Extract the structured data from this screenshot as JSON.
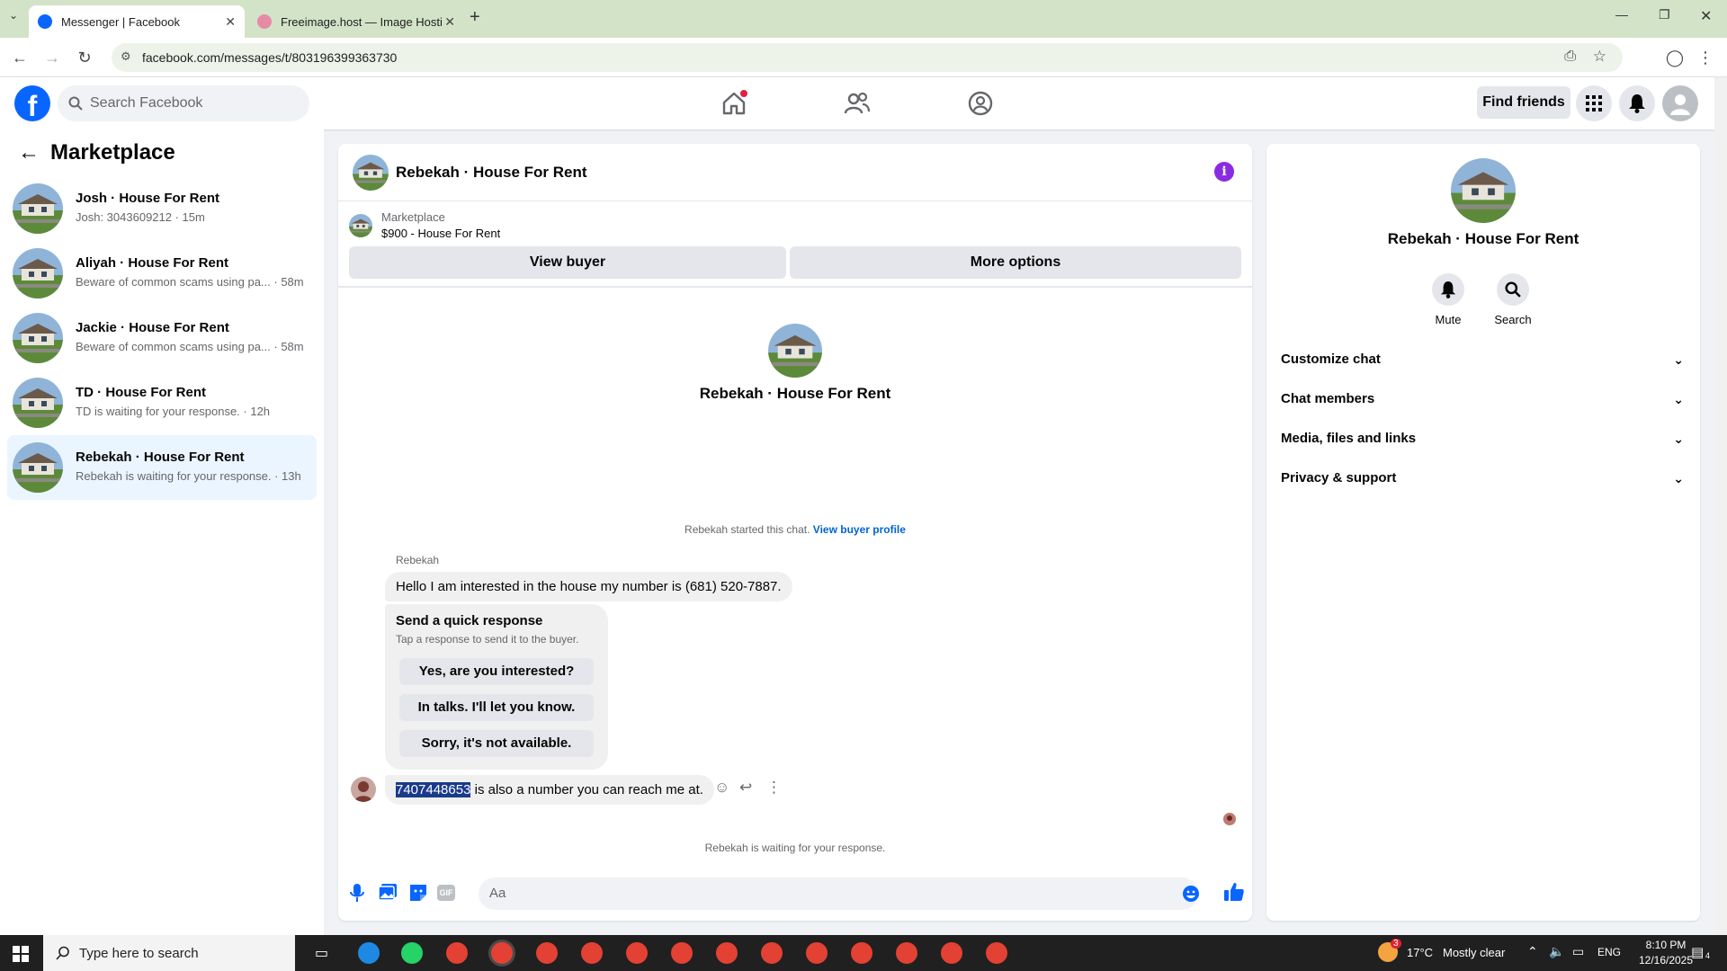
{
  "browser": {
    "tabs": [
      {
        "title": "Messenger | Facebook",
        "active": true
      },
      {
        "title": "Freeimage.host — Image Hosti",
        "active": false
      }
    ],
    "url": "facebook.com/messages/t/803196399363730"
  },
  "fb_header": {
    "search_placeholder": "Search Facebook",
    "find_friends_label": "Find friends"
  },
  "left_pane": {
    "title": "Marketplace",
    "conversations": [
      {
        "name": "Josh · House For Rent",
        "preview": "Josh: 3043609212 · 15m",
        "selected": false
      },
      {
        "name": "Aliyah · House For Rent",
        "preview": "Beware of common scams using pa... · 58m",
        "selected": false
      },
      {
        "name": "Jackie · House For Rent",
        "preview": "Beware of common scams using pa... · 58m",
        "selected": false
      },
      {
        "name": "TD · House For Rent",
        "preview": "TD is waiting for your response. · 12h",
        "selected": false
      },
      {
        "name": "Rebekah · House For Rent",
        "preview": "Rebekah is waiting for your response. · 13h",
        "selected": true
      }
    ]
  },
  "chat": {
    "title": "Rebekah · House For Rent",
    "listing": {
      "category": "Marketplace",
      "title": "$900 - House For Rent",
      "view_buyer_label": "View buyer",
      "more_options_label": "More options"
    },
    "profile_name": "Rebekah · House For Rent",
    "started_text": "Rebekah started this chat.",
    "view_profile_link": "View buyer profile",
    "sender_name": "Rebekah",
    "messages": {
      "first": "Hello I am interested in the house my number is (681) 520-7887.",
      "second_highlight": "7407448653",
      "second_rest": " is also a number you can reach me at."
    },
    "quick_response": {
      "title": "Send a quick response",
      "subtitle": "Tap a response to send it to the buyer.",
      "options": [
        "Yes, are you interested?",
        "In talks. I'll let you know.",
        "Sorry, it's not available."
      ]
    },
    "waiting_text": "Rebekah is waiting for your response.",
    "composer_placeholder": "Aa"
  },
  "right_pane": {
    "name": "Rebekah · House For Rent",
    "actions": [
      {
        "label": "Mute",
        "icon": "bell-icon"
      },
      {
        "label": "Search",
        "icon": "search-icon"
      }
    ],
    "sections": [
      "Customize chat",
      "Chat members",
      "Media, files and links",
      "Privacy & support"
    ]
  },
  "taskbar": {
    "search_placeholder": "Type here to search",
    "weather_temp": "17°C",
    "weather_text": "Mostly clear",
    "weather_badge": "3",
    "language": "ENG",
    "time": "8:10 PM",
    "date": "12/16/2025",
    "notification_count": "4"
  },
  "colors": {
    "fb_blue": "#0866ff",
    "messenger_purple": "#8a2be2",
    "selected_bg": "#ebf5ff",
    "tabbar_bg": "#d3e3c8"
  }
}
